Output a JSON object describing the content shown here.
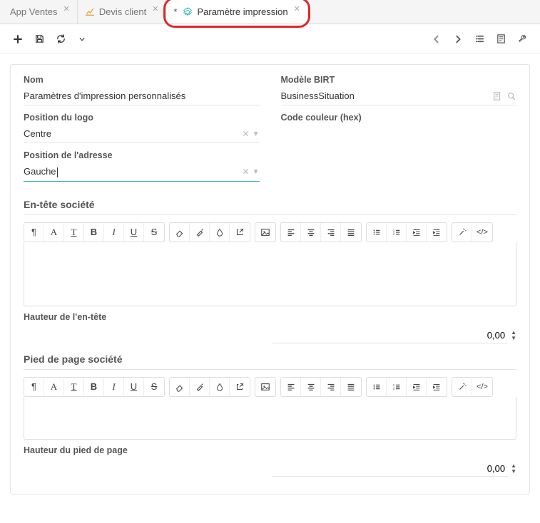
{
  "tabs": [
    {
      "label": "App Ventes"
    },
    {
      "label": "Devis client"
    },
    {
      "label": "Paramètre impression",
      "dirty": "*"
    }
  ],
  "form": {
    "nom": {
      "label": "Nom",
      "value": "Paramètres d'impression personnalisés"
    },
    "birt": {
      "label": "Modèle BIRT",
      "value": "BusinessSituation"
    },
    "logo": {
      "label": "Position du logo",
      "value": "Centre"
    },
    "color": {
      "label": "Code couleur (hex)"
    },
    "addr": {
      "label": "Position de l'adresse",
      "value": "Gauche"
    }
  },
  "sections": {
    "header": {
      "title": "En-tête société",
      "height_label": "Hauteur de l'en-tête",
      "height_value": "0,00"
    },
    "footer": {
      "title": "Pied de page société",
      "height_label": "Hauteur du pied de page",
      "height_value": "0,00"
    }
  },
  "rte_icons": {
    "pilcrow": "¶",
    "font": "A",
    "textcolor": "T",
    "bold": "B",
    "italic": "I",
    "underline": "U",
    "strike": "S",
    "eraser": "eraser",
    "brush": "brush",
    "drop": "drop",
    "extlink": "ext",
    "img": "img",
    "al": "al",
    "ac": "ac",
    "ar": "ar",
    "aj": "aj",
    "ul": "ul",
    "ol": "ol",
    "indent_in": "in",
    "indent_out": "out",
    "wand": "wand",
    "code": "</>"
  }
}
